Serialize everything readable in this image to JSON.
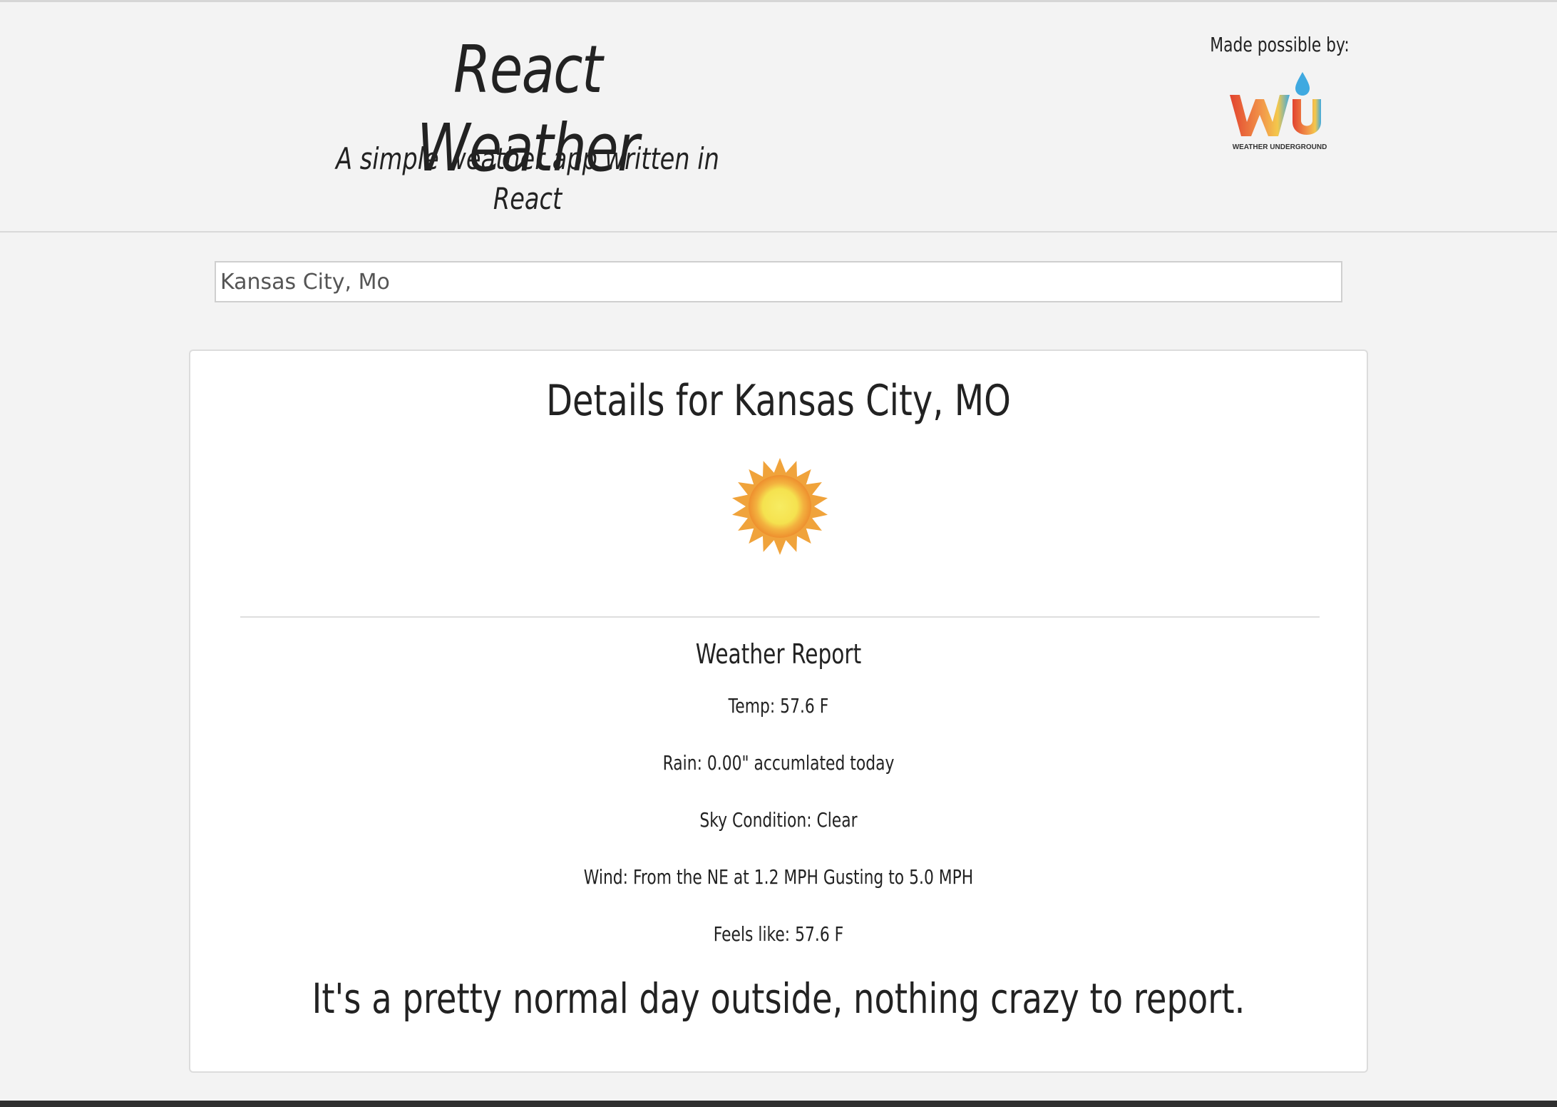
{
  "header": {
    "title": "React Weather",
    "subtitle": "A simple weather app written in React",
    "sponsor_label": "Made possible by:",
    "sponsor_logo_text": "WEATHER UNDERGROUND"
  },
  "search": {
    "value": "Kansas City, Mo",
    "placeholder": "Kansas City, Mo"
  },
  "details": {
    "title": "Details for Kansas City, MO",
    "icon": "sun-icon",
    "report_title": "Weather Report",
    "temp": "Temp: 57.6 F",
    "rain": "Rain: 0.00\" accumlated today",
    "sky": "Sky Condition: Clear",
    "wind": "Wind: From the NE at 1.2 MPH Gusting to 5.0 MPH",
    "feels_like": "Feels like: 57.6 F",
    "summary": "It's a pretty normal day outside, nothing crazy to report."
  },
  "colors": {
    "background": "#f3f3f3",
    "card": "#ffffff",
    "text": "#222222",
    "sun_core": "#f7ea5c",
    "sun_rays": "#f0a33b",
    "wu_red": "#e2432f",
    "wu_orange": "#f2994a",
    "wu_blue": "#3fa9e0"
  }
}
